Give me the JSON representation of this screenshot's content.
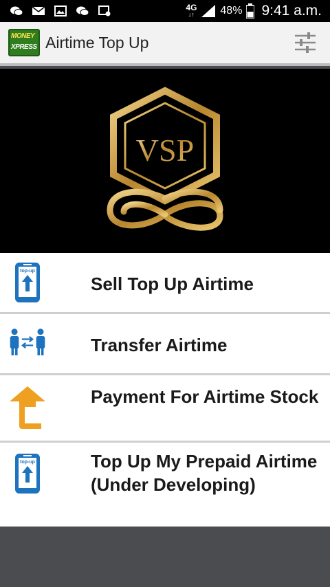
{
  "status_bar": {
    "network": "4G",
    "battery": "48%",
    "time": "9:41 a.m."
  },
  "app_bar": {
    "logo_line1": "MONEY",
    "logo_line2": "XPRESS",
    "title": "Airtime Top Up"
  },
  "banner": {
    "logo_text": "VSP"
  },
  "menu": {
    "items": [
      {
        "label": "Sell Top Up Airtime",
        "icon": "topup-phone-icon",
        "icon_text": "top-up"
      },
      {
        "label": "Transfer Airtime",
        "icon": "transfer-people-icon"
      },
      {
        "label": "Payment For Airtime Stock",
        "icon": "payment-arrow-icon"
      },
      {
        "label": "Top Up My Prepaid Airtime (Under Developing)",
        "icon": "topup-phone-icon",
        "icon_text": "top-up"
      }
    ]
  },
  "colors": {
    "accent_blue": "#1e73be",
    "accent_orange": "#f0a020",
    "gold": "#c9a24a"
  }
}
